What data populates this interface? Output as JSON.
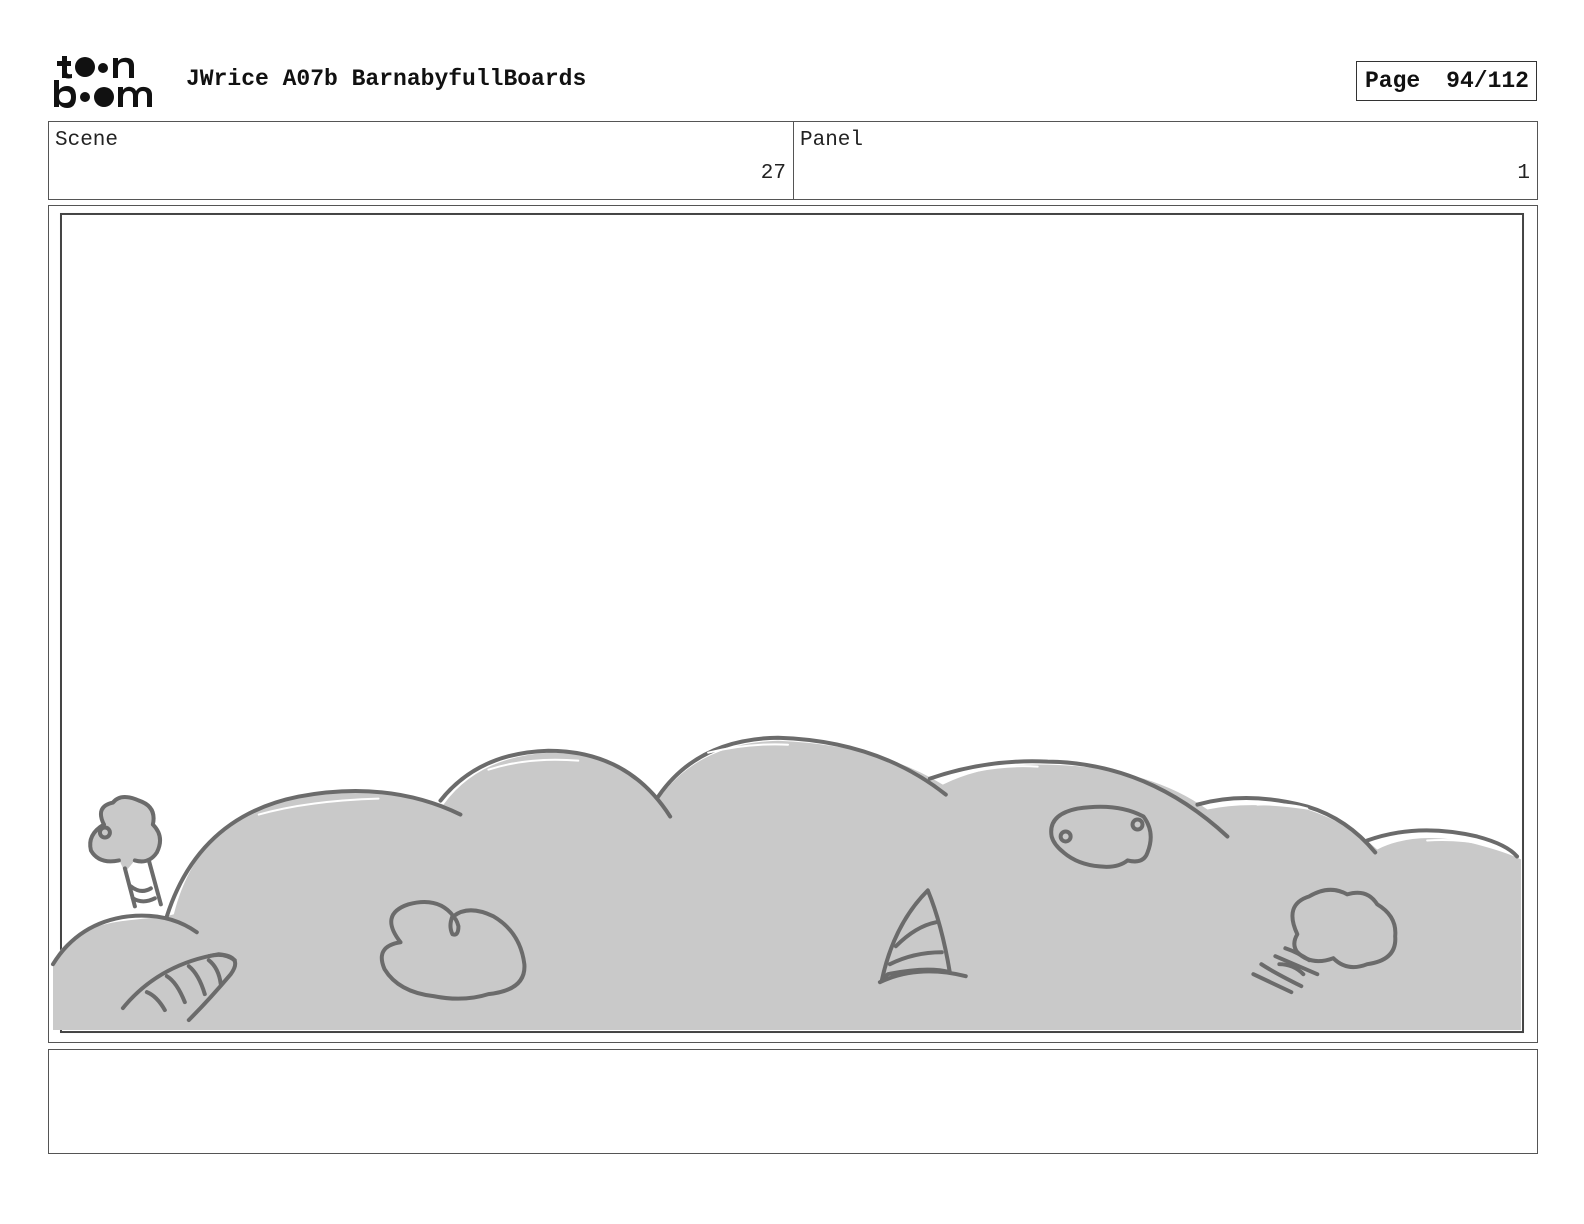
{
  "header": {
    "logo_text": "toon boom",
    "title": "JWrice A07b BarnabyfullBoards",
    "page_label": "Page",
    "page_value": "94/112"
  },
  "info": {
    "scene_label": "Scene",
    "scene_value": "27",
    "panel_label": "Panel",
    "panel_value": "1"
  },
  "colors": {
    "sketch_fill": "#c9c9c9",
    "sketch_line": "#6b6b6b",
    "frame_line": "#444444"
  },
  "notes": {
    "text": ""
  }
}
